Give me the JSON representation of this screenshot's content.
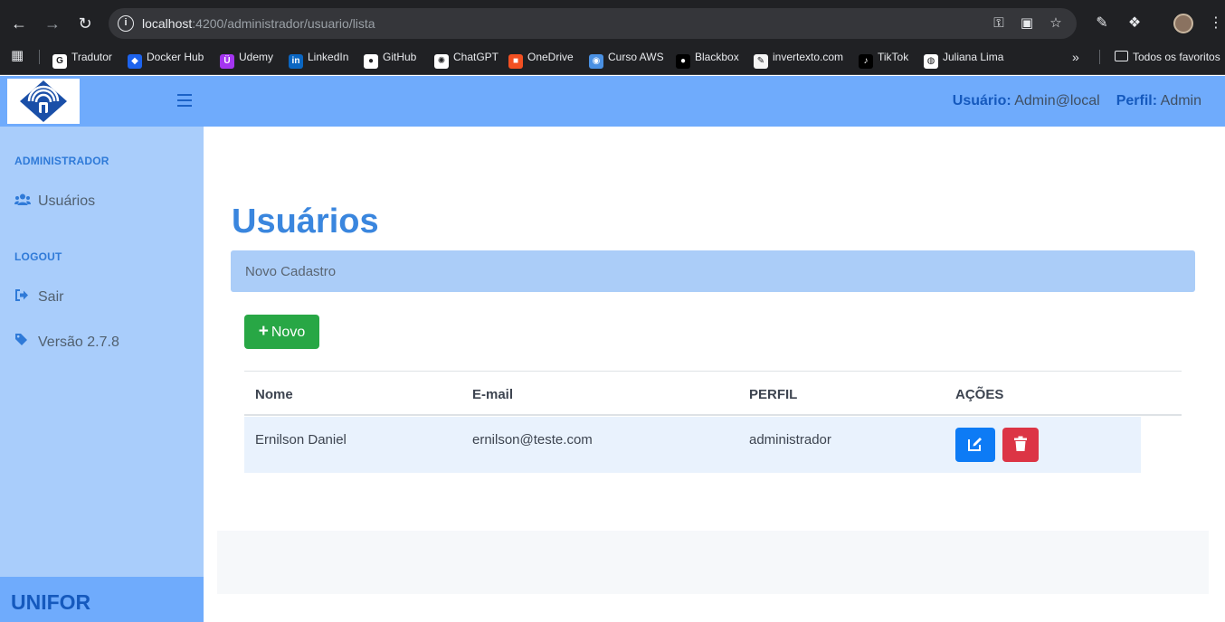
{
  "browser": {
    "url_host": "localhost",
    "url_rest": ":4200/administrador/usuario/lista",
    "bookmarks": [
      {
        "label": "Tradutor",
        "icon": "google-icon",
        "color": "#ffffff"
      },
      {
        "label": "Docker Hub",
        "icon": "docker-icon",
        "color": "#1d63ed"
      },
      {
        "label": "Udemy",
        "icon": "udemy-icon",
        "color": "#a435f0"
      },
      {
        "label": "LinkedIn",
        "icon": "linkedin-icon",
        "color": "#0a66c2"
      },
      {
        "label": "GitHub",
        "icon": "github-icon",
        "color": "#ffffff"
      },
      {
        "label": "ChatGPT",
        "icon": "chatgpt-icon",
        "color": "#ffffff"
      },
      {
        "label": "OneDrive",
        "icon": "microsoft-icon",
        "color": "#f25022"
      },
      {
        "label": "Curso AWS",
        "icon": "aws-icon",
        "color": "#4a90e2"
      },
      {
        "label": "Blackbox",
        "icon": "blackbox-icon",
        "color": "#000000"
      },
      {
        "label": "invertexto.com",
        "icon": "note-icon",
        "color": "#f5f5f5"
      },
      {
        "label": "TikTok",
        "icon": "tiktok-icon",
        "color": "#000000"
      },
      {
        "label": "Juliana Lima",
        "icon": "globe-icon",
        "color": "#ffffff"
      }
    ],
    "all_bookmarks": "Todos os favoritos"
  },
  "header": {
    "user_label": "Usuário:",
    "user_value": "Admin@local",
    "profile_label": "Perfil:",
    "profile_value": "Admin"
  },
  "sidebar": {
    "section_admin": "ADMINISTRADOR",
    "item_users": "Usuários",
    "section_logout": "LOGOUT",
    "item_exit": "Sair",
    "item_version": "Versão 2.7.8",
    "brand": "UNIFOR"
  },
  "main": {
    "title": "Usuários",
    "breadcrumb": "Novo Cadastro",
    "new_button": "Novo",
    "table": {
      "headers": [
        "Nome",
        "E-mail",
        "PERFIL",
        "AÇÕES"
      ],
      "rows": [
        {
          "nome": "Ernilson Daniel",
          "email": "ernilson@teste.com",
          "perfil": "administrador"
        }
      ]
    }
  },
  "colors": {
    "header_bg": "#6fabfc",
    "sidebar_bg": "#a9cdfb",
    "primary": "#3a86de",
    "success": "#28a745",
    "danger": "#dc3545"
  }
}
